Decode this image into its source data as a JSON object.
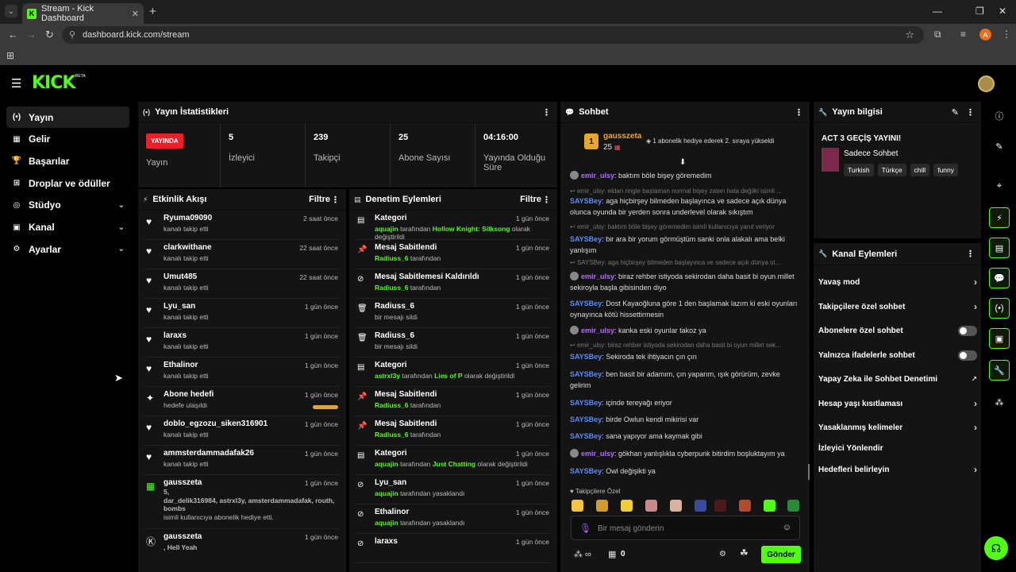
{
  "browser": {
    "tab_title": "Stream - Kick Dashboard",
    "url": "dashboard.kick.com/stream",
    "profile_initial": "A"
  },
  "brand": {
    "logo": "KICK",
    "beta": "BETA",
    "accent": "#53fc18"
  },
  "sidebar": {
    "items": [
      {
        "label": "Yayın",
        "icon": "broadcast-icon",
        "glyph": "(•)"
      },
      {
        "label": "Gelir",
        "icon": "revenue-icon",
        "glyph": "▦"
      },
      {
        "label": "Başarılar",
        "icon": "trophy-icon",
        "glyph": "🏆"
      },
      {
        "label": "Droplar ve ödüller",
        "icon": "gift-icon",
        "glyph": "⊞"
      },
      {
        "label": "Stüdyo",
        "icon": "studio-icon",
        "glyph": "◎"
      },
      {
        "label": "Kanal",
        "icon": "channel-icon",
        "glyph": "▣"
      },
      {
        "label": "Ayarlar",
        "icon": "gear-icon",
        "glyph": "⚙"
      }
    ]
  },
  "stats": {
    "title": "Yayın İstatistikleri",
    "live_badge": "YAYINDA",
    "live_label": "Yayın",
    "viewers": "5",
    "viewers_label": "İzleyici",
    "followers": "239",
    "followers_label": "Takipçi",
    "subs": "25",
    "subs_label": "Abone Sayısı",
    "uptime": "04:16:00",
    "uptime_label": "Yayında Olduğu Süre"
  },
  "activity": {
    "title": "Etkinlik Akışı",
    "filter": "Filtre",
    "rows": [
      {
        "name": "Ryuma09090",
        "sub": "kanalı takip etti",
        "time": "2 saat önce",
        "icon": "♥"
      },
      {
        "name": "clarkwithane",
        "sub": "kanalı takip etti",
        "time": "22 saat önce",
        "icon": "♥"
      },
      {
        "name": "Umut485",
        "sub": "kanalı takip etti",
        "time": "22 saat önce",
        "icon": "♥"
      },
      {
        "name": "Lyu_san",
        "sub": "kanalı takip etti",
        "time": "1 gün önce",
        "icon": "♥"
      },
      {
        "name": "laraxs",
        "sub": "kanalı takip etti",
        "time": "1 gün önce",
        "icon": "♥"
      },
      {
        "name": "Ethalinor",
        "sub": "kanalı takip etti",
        "time": "1 gün önce",
        "icon": "♥"
      },
      {
        "name": "Abone hedefi",
        "sub": "hedefe ulaşıldı",
        "time": "1 gün önce",
        "icon": "✦"
      },
      {
        "name": "doblo_egzozu_siken316901",
        "sub": "kanalı takip etti",
        "time": "1 gün önce",
        "icon": "♥"
      },
      {
        "name": "ammsterdammadafak26",
        "sub": "kanalı takip etti",
        "time": "1 gün önce",
        "icon": "♥"
      }
    ],
    "gift": {
      "name": "gausszeta",
      "line1": "5,",
      "line2": "dar_delik316984, astrxl3y, amsterdammadafak, routh,",
      "line3": "bombs",
      "sub": "isimli kullanıcıya abonelik hediye etti.",
      "time": "1 gün önce"
    },
    "last": {
      "name": "gausszeta",
      "sub": ", Hell Yeah",
      "time": "1 gün önce"
    }
  },
  "moderation": {
    "title": "Denetim Eylemleri",
    "filter": "Filtre",
    "rows": [
      {
        "title": "Kategori",
        "who": "aquajin",
        "mid": " tarafından ",
        "what": "Hollow Knight: Silksong",
        "tail": " olarak değiştirildi",
        "time": "1 gün önce",
        "icon": "▤"
      },
      {
        "title": "Mesaj Sabitlendi",
        "who": "Radiuss_6",
        "mid": " tarafından",
        "what": "",
        "tail": "",
        "time": "1 gün önce",
        "icon": "📌"
      },
      {
        "title": "Mesaj Sabitlemesi Kaldırıldı",
        "who": "Radiuss_6",
        "mid": " tarafından",
        "what": "",
        "tail": "",
        "time": "1 gün önce",
        "icon": "⊘"
      },
      {
        "title": "Radiuss_6",
        "who": "",
        "mid": "bir mesajı sildi",
        "what": "",
        "tail": "",
        "time": "1 gün önce",
        "icon": "🗑"
      },
      {
        "title": "Radiuss_6",
        "who": "",
        "mid": "bir mesajı sildi",
        "what": "",
        "tail": "",
        "time": "1 gün önce",
        "icon": "🗑"
      },
      {
        "title": "Kategori",
        "who": "astrxl3y",
        "mid": " tarafından ",
        "what": "Lies of P",
        "tail": " olarak değiştirildi",
        "time": "1 gün önce",
        "icon": "▤"
      },
      {
        "title": "Mesaj Sabitlendi",
        "who": "Radiuss_6",
        "mid": " tarafından",
        "what": "",
        "tail": "",
        "time": "1 gün önce",
        "icon": "📌"
      },
      {
        "title": "Mesaj Sabitlendi",
        "who": "Radiuss_6",
        "mid": " tarafından",
        "what": "",
        "tail": "",
        "time": "1 gün önce",
        "icon": "📌"
      },
      {
        "title": "Kategori",
        "who": "aquajin",
        "mid": " tarafından ",
        "what": "Just Chatting",
        "tail": " olarak değiştirildi",
        "time": "1 gün önce",
        "icon": "▤"
      },
      {
        "title": "Lyu_san",
        "who": "aquajin",
        "mid": " tarafından yasaklandı",
        "what": "",
        "tail": "",
        "time": "1 gün önce",
        "icon": "⊘"
      },
      {
        "title": "Ethalinor",
        "who": "aquajin",
        "mid": " tarafından yasaklandı",
        "what": "",
        "tail": "",
        "time": "1 gün önce",
        "icon": "⊘"
      },
      {
        "title": "laraxs",
        "who": "",
        "mid": "",
        "what": "",
        "tail": "",
        "time": "1 gün önce",
        "icon": "⊘"
      }
    ]
  },
  "chat": {
    "title": "Sohbet",
    "pinned_user": "gausszeta",
    "pinned_rank": "1",
    "pinned_count": "25",
    "pinned_text": "1 abonelik hediye ederek 2. sıraya yükseldi",
    "messages": [
      {
        "reply": "",
        "user": "emir_ulsy",
        "color": "#b36cf7",
        "avatar": true,
        "text": "baktım böle bişey göremedim"
      },
      {
        "reply": "emir_ulsy: eldan ringle başlaman normal bişey zaten hata değilki isimli ...",
        "user": "SAYSBey",
        "color": "#5b8cf5",
        "avatar": false,
        "text": "aga hiçbirşey bilmeden başlayınca ve sadece açık dünya olunca oyunda bir yerden sonra underlevel olarak sıkıştım"
      },
      {
        "reply": "emir_ulsy: baktım böle bişey göremedim isimli kullanıcıya yanıt veriyor",
        "user": "SAYSBey",
        "color": "#5b8cf5",
        "avatar": false,
        "text": "bir ara bir yorum görmüştüm sanki onla alakalı ama belki yanlışım"
      },
      {
        "reply": "SAYSBey: aga hiçbirşey bilmeden başlayınca ve sadece açık dünya ol...",
        "user": "emir_ulsy",
        "color": "#b36cf7",
        "avatar": true,
        "text": "biraz rehber istiyoda sekirodan daha basit bi oyun millet sekiroyla başla gibisinden diyo"
      },
      {
        "reply": "",
        "user": "SAYSBey",
        "color": "#5b8cf5",
        "avatar": false,
        "text": "Dost Kayaoğluna göre 1 den başlamak lazım ki eski oyunları oynayınca kötü hissettirmesin"
      },
      {
        "reply": "",
        "user": "emir_ulsy",
        "color": "#b36cf7",
        "avatar": true,
        "text": "kanka eski oyunlar takoz ya"
      },
      {
        "reply": "emir_ulsy: biraz rehber istiyoda sekirodan daha basit bi oyun millet sek...",
        "user": "SAYSBey",
        "color": "#5b8cf5",
        "avatar": false,
        "text": "Sekiroda tek ihtiyacın çın çın"
      },
      {
        "reply": "",
        "user": "SAYSBey",
        "color": "#5b8cf5",
        "avatar": false,
        "text": "ben basit bir adamım, çın yaparım, ışık görürüm, zevke gelirim"
      },
      {
        "reply": "",
        "user": "SAYSBey",
        "color": "#5b8cf5",
        "avatar": false,
        "text": "içinde tereyağı eriyor"
      },
      {
        "reply": "",
        "user": "SAYSBey",
        "color": "#5b8cf5",
        "avatar": false,
        "text": "birde Owlun kendi mikirisi var"
      },
      {
        "reply": "",
        "user": "SAYSBey",
        "color": "#5b8cf5",
        "avatar": false,
        "text": "sana yapıyor ama kaymak gibi"
      },
      {
        "reply": "",
        "user": "emir_ulsy",
        "color": "#b36cf7",
        "avatar": true,
        "text": "gökhan yanlışlıkla cyberpunk bitirdim boşluktayım ya"
      },
      {
        "reply": "",
        "user": "SAYSBey",
        "color": "#5b8cf5",
        "avatar": false,
        "text": "Owl değişikti ya"
      }
    ],
    "followers_only": "Takipçilere Özel",
    "input_placeholder": "Bir mesaj gönderin",
    "points": "0",
    "send": "Gönder"
  },
  "stream_info": {
    "title": "Yayın bilgisi",
    "stream_title": "ACT 3 GEÇİŞ YAYINI!",
    "category": "Sadece Sohbet",
    "tags": [
      "Turkish",
      "Türkçe",
      "chill",
      "funny"
    ]
  },
  "channel_actions": {
    "title": "Kanal Eylemleri",
    "items": [
      {
        "label": "Yavaş mod",
        "control": "arrow"
      },
      {
        "label": "Takipçilere özel sohbet",
        "control": "arrow"
      },
      {
        "label": "Abonelere özel sohbet",
        "control": "toggle"
      },
      {
        "label": "Yalnızca ifadelerle sohbet",
        "control": "toggle"
      },
      {
        "label": "Yapay Zeka ile Sohbet Denetimi",
        "control": "external"
      },
      {
        "label": "Hesap yaşı kısıtlaması",
        "control": "arrow"
      },
      {
        "label": "Yasaklanmış kelimeler",
        "control": "arrow"
      },
      {
        "label": "İzleyici Yönlendir",
        "control": "none"
      },
      {
        "label": "Hedefleri belirleyin",
        "control": "arrow"
      }
    ]
  }
}
